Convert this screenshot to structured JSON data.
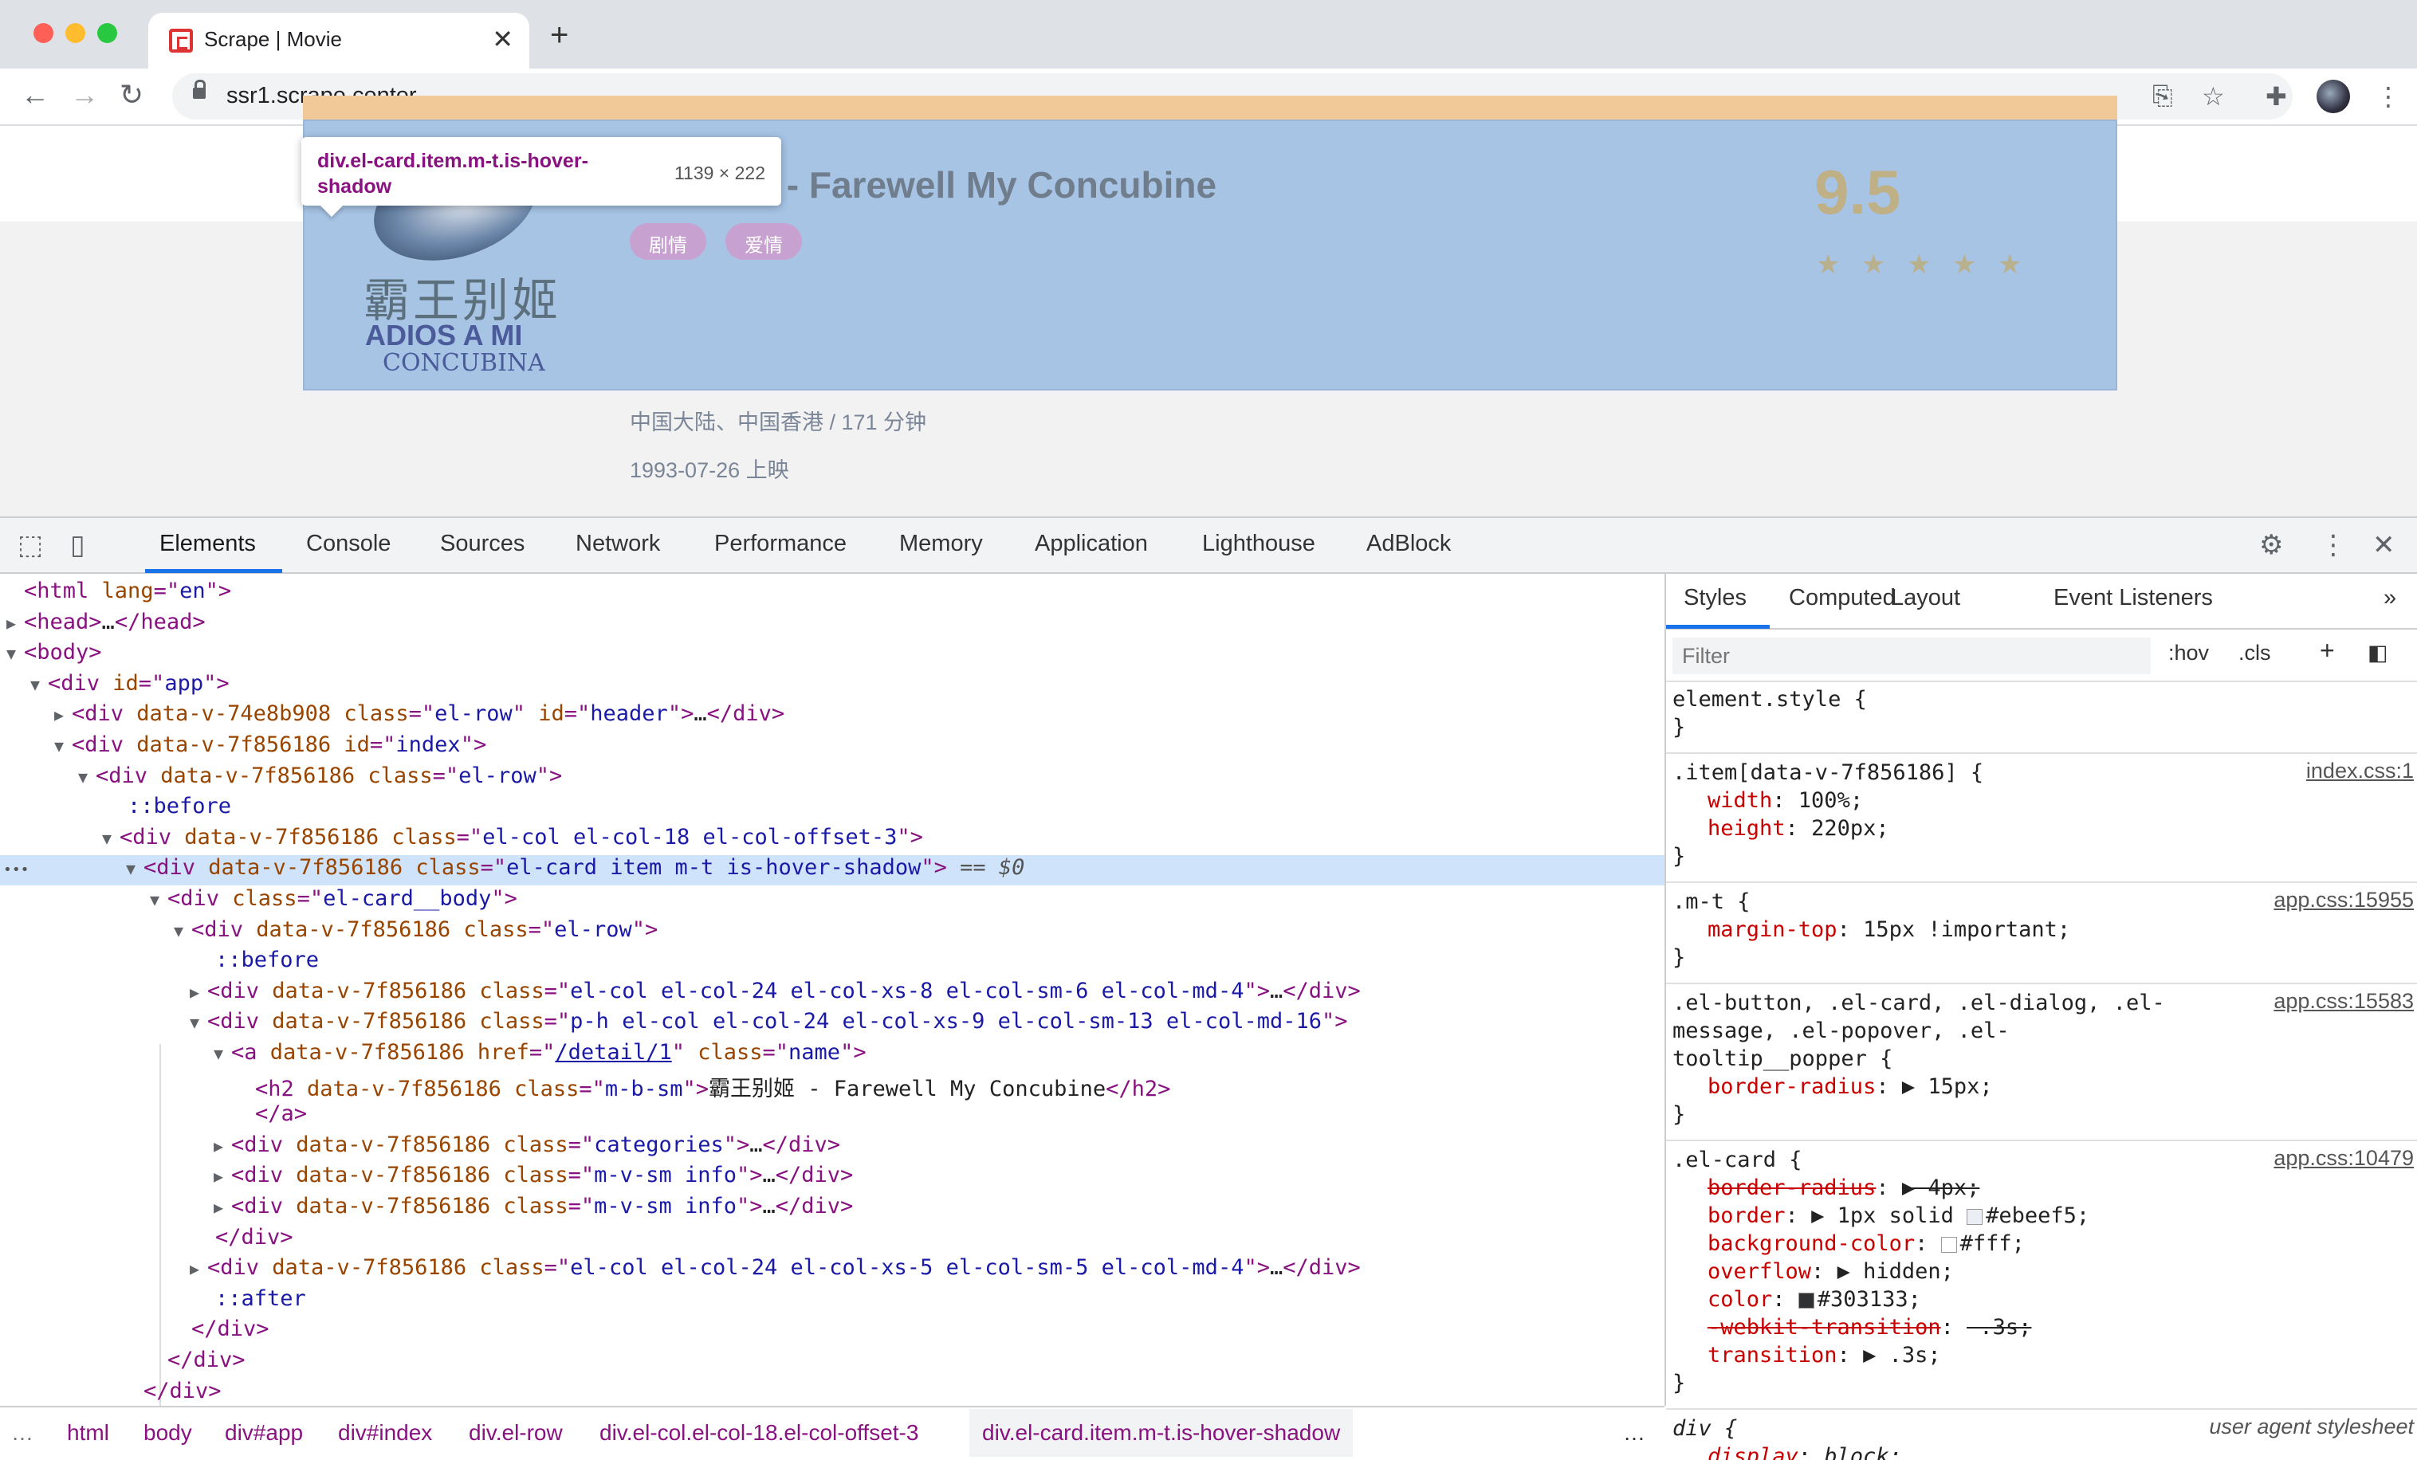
{
  "browser": {
    "tab_title": "Scrape | Movie",
    "url": "ssr1.scrape.center",
    "new_tab": "+",
    "tab_close": "✕"
  },
  "page": {
    "tooltip_selector": "div.el-card.item.m-t.is-hover-shadow",
    "tooltip_dims": "1139 × 222",
    "movie": {
      "title": "霸王别姬 - Farewell My Concubine",
      "categories": [
        "剧情",
        "爱情"
      ],
      "info": "中国大陆、中国香港 / 171 分钟",
      "release": "1993-07-26 上映",
      "score": "9.5",
      "stars": 5,
      "poster_cn": "霸王别姬",
      "poster_en1": "ADIOS A MI",
      "poster_en2": "CONCUBINA"
    }
  },
  "devtools": {
    "tabs": [
      "Elements",
      "Console",
      "Sources",
      "Network",
      "Performance",
      "Memory",
      "Application",
      "Lighthouse",
      "AdBlock"
    ],
    "active_tab": "Elements",
    "dom": [
      {
        "tw": "",
        "parts": [
          [
            "t",
            "<html "
          ],
          [
            "an",
            "lang"
          ],
          [
            "t",
            "=\""
          ],
          [
            "av",
            "en"
          ],
          [
            "t",
            "\">"
          ]
        ]
      },
      {
        "tw": "▶",
        "parts": [
          [
            "t",
            "<head>"
          ],
          [
            "tx",
            "…"
          ],
          [
            "t",
            "</head>"
          ]
        ]
      },
      {
        "tw": "▼",
        "parts": [
          [
            "t",
            "<body>"
          ]
        ]
      },
      {
        "tw": "▼",
        "parts": [
          [
            "t",
            "<div "
          ],
          [
            "an",
            "id"
          ],
          [
            "t",
            "=\""
          ],
          [
            "av",
            "app"
          ],
          [
            "t",
            "\">"
          ]
        ]
      },
      {
        "tw": "▶",
        "parts": [
          [
            "t",
            "<div "
          ],
          [
            "an",
            "data-v-74e8b908 class"
          ],
          [
            "t",
            "=\""
          ],
          [
            "av",
            "el-row"
          ],
          [
            "t",
            "\" "
          ],
          [
            "an",
            "id"
          ],
          [
            "t",
            "=\""
          ],
          [
            "av",
            "header"
          ],
          [
            "t",
            "\">"
          ],
          [
            "tx",
            "…"
          ],
          [
            "t",
            "</div>"
          ]
        ]
      },
      {
        "tw": "▼",
        "parts": [
          [
            "t",
            "<div "
          ],
          [
            "an",
            "data-v-7f856186 id"
          ],
          [
            "t",
            "=\""
          ],
          [
            "av",
            "index"
          ],
          [
            "t",
            "\">"
          ]
        ]
      },
      {
        "tw": "▼",
        "parts": [
          [
            "t",
            "<div "
          ],
          [
            "an",
            "data-v-7f856186 class"
          ],
          [
            "t",
            "=\""
          ],
          [
            "av",
            "el-row"
          ],
          [
            "t",
            "\">"
          ]
        ]
      },
      {
        "tw": "",
        "parts": [
          [
            "ps",
            "::before"
          ]
        ]
      },
      {
        "tw": "▼",
        "parts": [
          [
            "t",
            "<div "
          ],
          [
            "an",
            "data-v-7f856186 class"
          ],
          [
            "t",
            "=\""
          ],
          [
            "av",
            "el-col el-col-18 el-col-offset-3"
          ],
          [
            "t",
            "\">"
          ]
        ]
      },
      {
        "tw": "▼",
        "parts": [
          [
            "t",
            "<div "
          ],
          [
            "an",
            "data-v-7f856186 class"
          ],
          [
            "t",
            "=\""
          ],
          [
            "av",
            "el-card item m-t is-hover-shadow"
          ],
          [
            "t",
            "\">"
          ],
          [
            "dl",
            " == $0"
          ]
        ]
      },
      {
        "tw": "▼",
        "parts": [
          [
            "t",
            "<div "
          ],
          [
            "an",
            "class"
          ],
          [
            "t",
            "=\""
          ],
          [
            "av",
            "el-card__body"
          ],
          [
            "t",
            "\">"
          ]
        ]
      },
      {
        "tw": "▼",
        "parts": [
          [
            "t",
            "<div "
          ],
          [
            "an",
            "data-v-7f856186 class"
          ],
          [
            "t",
            "=\""
          ],
          [
            "av",
            "el-row"
          ],
          [
            "t",
            "\">"
          ]
        ]
      },
      {
        "tw": "",
        "parts": [
          [
            "ps",
            "::before"
          ]
        ]
      },
      {
        "tw": "▶",
        "parts": [
          [
            "t",
            "<div "
          ],
          [
            "an",
            "data-v-7f856186 class"
          ],
          [
            "t",
            "=\""
          ],
          [
            "av",
            "el-col el-col-24 el-col-xs-8 el-col-sm-6 el-col-md-4"
          ],
          [
            "t",
            "\">"
          ],
          [
            "tx",
            "…"
          ],
          [
            "t",
            "</div>"
          ]
        ]
      },
      {
        "tw": "▼",
        "parts": [
          [
            "t",
            "<div "
          ],
          [
            "an",
            "data-v-7f856186 class"
          ],
          [
            "t",
            "=\""
          ],
          [
            "av",
            "p-h el-col el-col-24 el-col-xs-9 el-col-sm-13 el-col-md-16"
          ],
          [
            "t",
            "\">"
          ]
        ]
      },
      {
        "tw": "▼",
        "parts": [
          [
            "t",
            "<a "
          ],
          [
            "an",
            "data-v-7f856186 href"
          ],
          [
            "t",
            "=\""
          ],
          [
            "lk",
            "/detail/1"
          ],
          [
            "t",
            "\" "
          ],
          [
            "an",
            "class"
          ],
          [
            "t",
            "=\""
          ],
          [
            "av",
            "name"
          ],
          [
            "t",
            "\">"
          ]
        ]
      },
      {
        "tw": "",
        "parts": [
          [
            "t",
            "<h2 "
          ],
          [
            "an",
            "data-v-7f856186 class"
          ],
          [
            "t",
            "=\""
          ],
          [
            "av",
            "m-b-sm"
          ],
          [
            "t",
            "\">"
          ],
          [
            "tx",
            "霸王别姬 - Farewell My Concubine"
          ],
          [
            "t",
            "</h2>"
          ]
        ]
      },
      {
        "tw": "",
        "parts": [
          [
            "t",
            "</a>"
          ]
        ]
      },
      {
        "tw": "▶",
        "parts": [
          [
            "t",
            "<div "
          ],
          [
            "an",
            "data-v-7f856186 class"
          ],
          [
            "t",
            "=\""
          ],
          [
            "av",
            "categories"
          ],
          [
            "t",
            "\">"
          ],
          [
            "tx",
            "…"
          ],
          [
            "t",
            "</div>"
          ]
        ]
      },
      {
        "tw": "▶",
        "parts": [
          [
            "t",
            "<div "
          ],
          [
            "an",
            "data-v-7f856186 class"
          ],
          [
            "t",
            "=\""
          ],
          [
            "av",
            "m-v-sm info"
          ],
          [
            "t",
            "\">"
          ],
          [
            "tx",
            "…"
          ],
          [
            "t",
            "</div>"
          ]
        ]
      },
      {
        "tw": "▶",
        "parts": [
          [
            "t",
            "<div "
          ],
          [
            "an",
            "data-v-7f856186 class"
          ],
          [
            "t",
            "=\""
          ],
          [
            "av",
            "m-v-sm info"
          ],
          [
            "t",
            "\">"
          ],
          [
            "tx",
            "…"
          ],
          [
            "t",
            "</div>"
          ]
        ]
      },
      {
        "tw": "",
        "parts": [
          [
            "t",
            "</div>"
          ]
        ]
      },
      {
        "tw": "▶",
        "parts": [
          [
            "t",
            "<div "
          ],
          [
            "an",
            "data-v-7f856186 class"
          ],
          [
            "t",
            "=\""
          ],
          [
            "av",
            "el-col el-col-24 el-col-xs-5 el-col-sm-5 el-col-md-4"
          ],
          [
            "t",
            "\">"
          ],
          [
            "tx",
            "…"
          ],
          [
            "t",
            "</div>"
          ]
        ]
      },
      {
        "tw": "",
        "parts": [
          [
            "ps",
            "::after"
          ]
        ]
      },
      {
        "tw": "",
        "parts": [
          [
            "t",
            "</div>"
          ]
        ]
      },
      {
        "tw": "",
        "parts": [
          [
            "t",
            "</div>"
          ]
        ]
      },
      {
        "tw": "",
        "parts": [
          [
            "t",
            "</div>"
          ]
        ]
      }
    ],
    "styles_tabs": [
      "Styles",
      "Computed",
      "Layout",
      "Event Listeners"
    ],
    "filter_placeholder": "Filter",
    "hov": ":hov",
    "cls": ".cls",
    "rules": [
      {
        "selector": "element.style {",
        "source": "",
        "lines": [],
        "close": "}"
      },
      {
        "selector": ".item[data-v-7f856186] {",
        "source": "index.css:1",
        "lines": [
          {
            "p": "width",
            "v": "100%;"
          },
          {
            "p": "height",
            "v": "220px;"
          }
        ],
        "close": "}"
      },
      {
        "selector": ".m-t {",
        "source": "app.css:15955",
        "lines": [
          {
            "p": "margin-top",
            "v": "15px !important;"
          }
        ],
        "close": "}"
      },
      {
        "selector": ".el-button, .el-card, .el-dialog, .el-\nmessage, .el-popover, .el-\ntooltip__popper {",
        "source": "app.css:15583",
        "lines": [
          {
            "p": "border-radius",
            "v": "▶ 15px;"
          }
        ],
        "close": "}"
      },
      {
        "selector": ".el-card {",
        "source": "app.css:10479",
        "lines": [
          {
            "p": "border-radius",
            "v": "▶ 4px;",
            "strike": true
          },
          {
            "p": "border",
            "v": "▶ 1px solid ",
            "sw": "#ebeef5",
            "after": "#ebeef5;"
          },
          {
            "p": "background-color",
            "v": "",
            "sw": "#ffffff",
            "after": "#fff;"
          },
          {
            "p": "overflow",
            "v": "▶ hidden;"
          },
          {
            "p": "color",
            "v": "",
            "sw": "#303133",
            "after": "#303133;"
          },
          {
            "p": "-webkit-transition",
            "v": " .3s;",
            "strike": true
          },
          {
            "p": "transition",
            "v": "▶ .3s;"
          }
        ],
        "close": "}"
      },
      {
        "selector": "div {",
        "source": "user agent stylesheet",
        "lines": [
          {
            "p": "display",
            "v": "block;"
          }
        ],
        "close": ""
      }
    ],
    "breadcrumbs": [
      "html",
      "body",
      "div#app",
      "div#index",
      "div.el-row",
      "div.el-col.el-col-18.el-col-offset-3",
      "div.el-card.item.m-t.is-hover-shadow"
    ]
  },
  "colors": {
    "highlight_content": "#a7c4e5",
    "highlight_margin": "#f1c998",
    "tag_bg": "#c7a2d0",
    "active_tab_underline": "#1a73e8"
  }
}
